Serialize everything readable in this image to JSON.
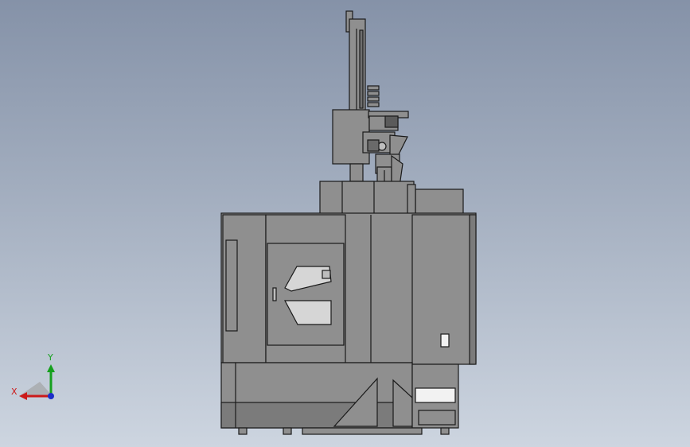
{
  "colors": {
    "background_top": "#8592a8",
    "background_bottom": "#cdd5e0",
    "body_fill": "#8f8f8f",
    "body_fill_dark": "#7b7b7b",
    "outline": "#1a1a1a",
    "window_fill": "#d6d6d6",
    "x_axis": "#cc1a1a",
    "y_axis": "#16a01e",
    "z_axis": "#1c2fc8"
  },
  "triad": {
    "x_label": "X",
    "y_label": "Y"
  }
}
